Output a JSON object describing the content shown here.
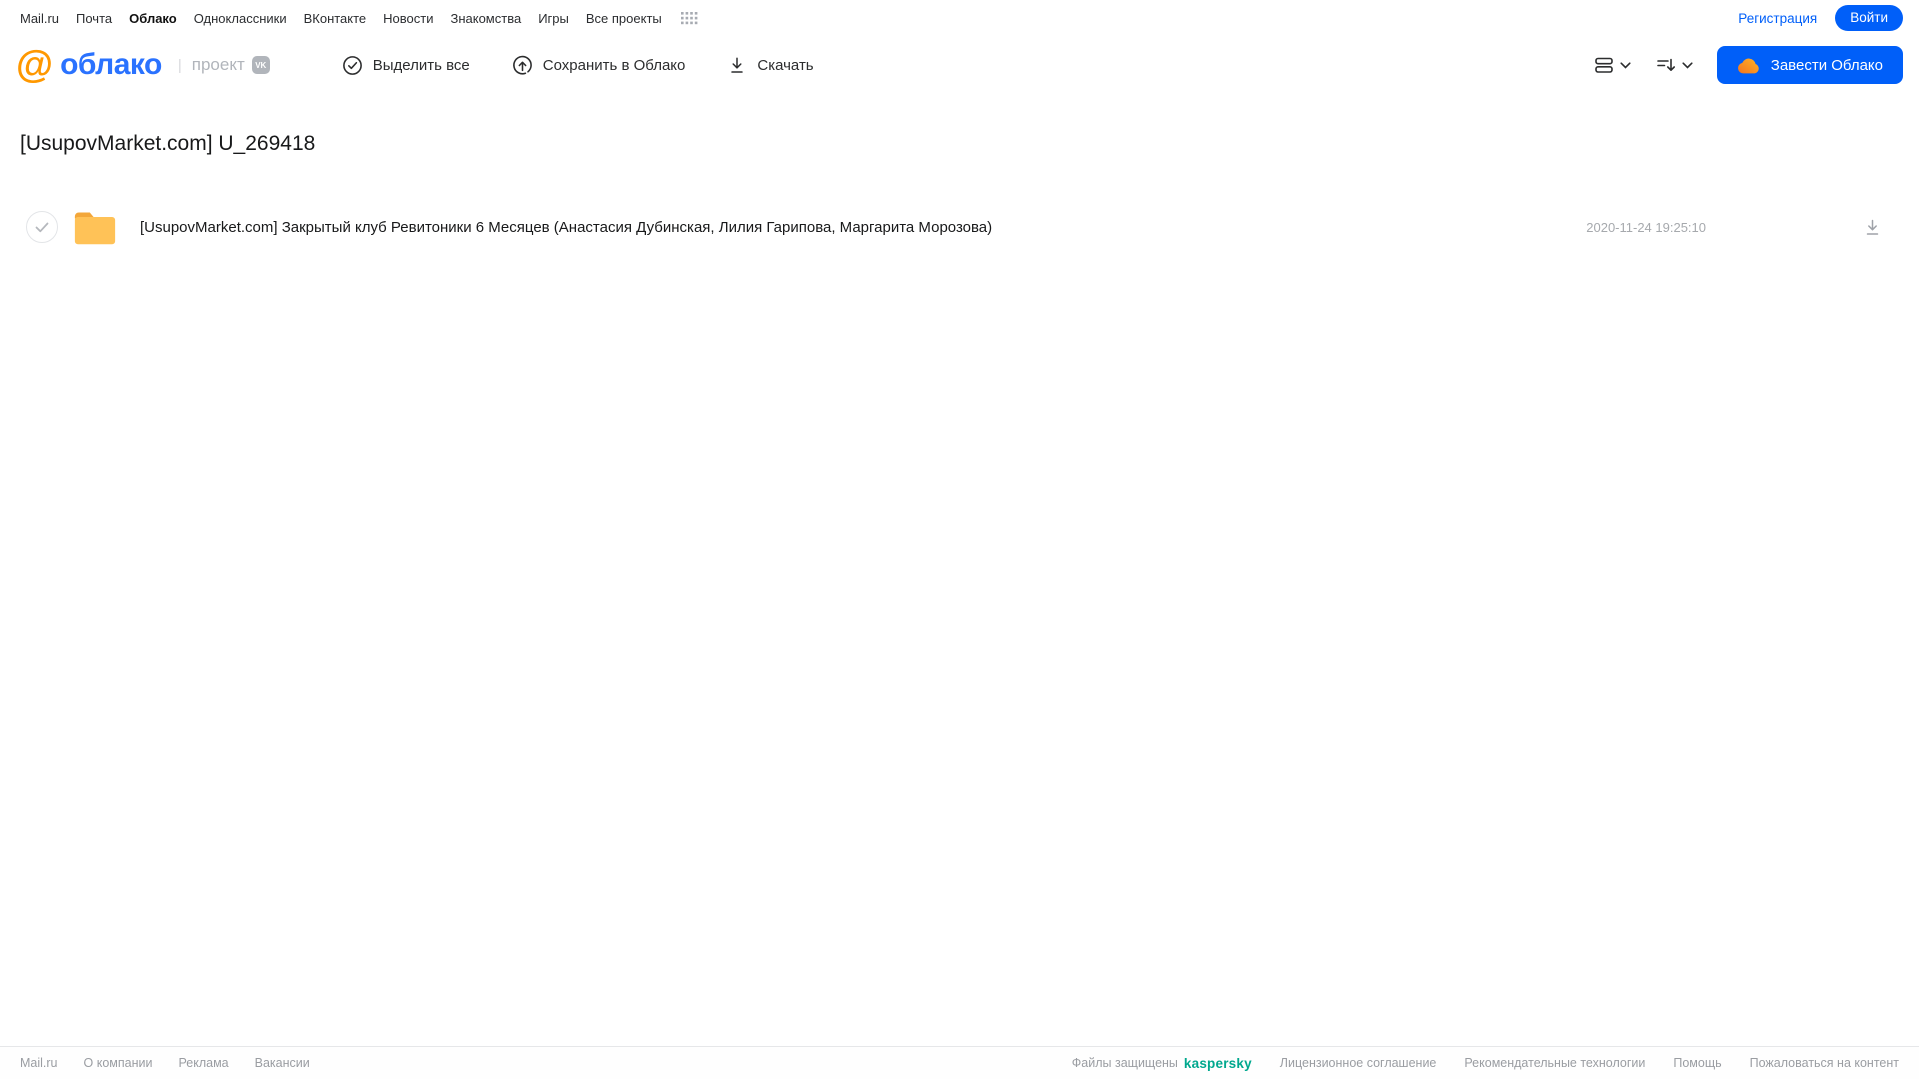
{
  "topnav": {
    "items": [
      "Mail.ru",
      "Почта",
      "Облако",
      "Одноклассники",
      "ВКонтакте",
      "Новости",
      "Знакомства",
      "Игры",
      "Все проекты"
    ],
    "register": "Регистрация",
    "login": "Войти"
  },
  "header": {
    "logo_at": "@",
    "logo_text": "облако",
    "project_label": "проект",
    "vk_badge": "VK",
    "toolbar": {
      "select_all": "Выделить все",
      "save_to_cloud": "Сохранить в Облако",
      "download": "Скачать"
    },
    "get_cloud_button": "Завести Облако"
  },
  "main": {
    "title": "[UsupovMarket.com] U_269418",
    "files": [
      {
        "name": "[UsupovMarket.com] Закрытый клуб Ревитоники 6 Месяцев (Анастасия Дубинская, Лилия Гарипова, Маргарита Морозова)",
        "date": "2020-11-24 19:25:10"
      }
    ]
  },
  "footer": {
    "left_links": [
      "Mail.ru",
      "О компании",
      "Реклама",
      "Вакансии"
    ],
    "protected_text": "Файлы защищены",
    "kaspersky": "kaspersky",
    "right_links": [
      "Лицензионное соглашение",
      "Рекомендательные технологии",
      "Помощь",
      "Пожаловаться на контент"
    ]
  },
  "colors": {
    "primary_blue": "#005ff9",
    "logo_blue": "#2a72ff",
    "logo_orange": "#ff9800",
    "folder_yellow": "#ffc257",
    "folder_tab": "#f3a73a",
    "kaspersky_green": "#00a88e",
    "muted_gray": "#9a9da2"
  }
}
